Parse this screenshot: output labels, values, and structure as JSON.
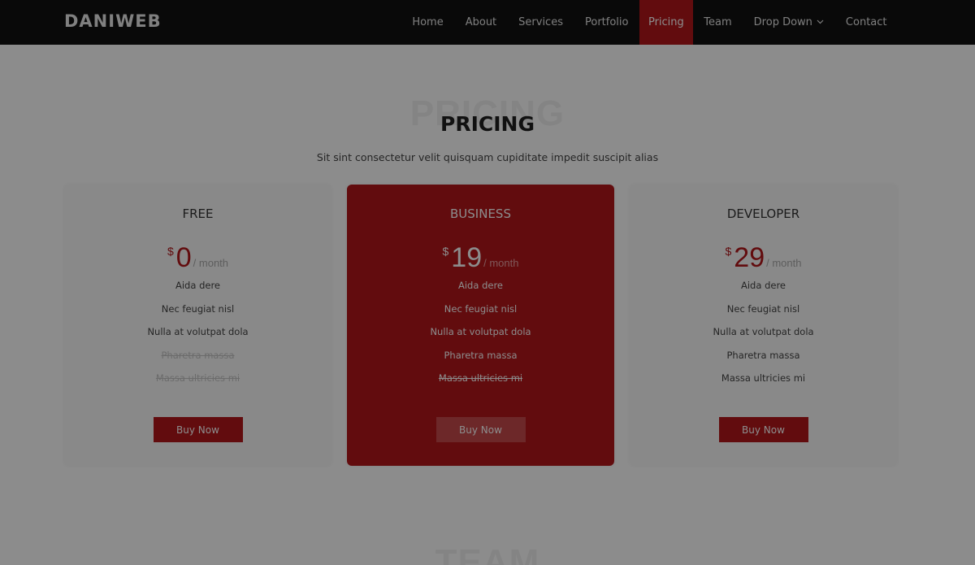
{
  "header": {
    "logo": "DANIWEB",
    "nav": [
      {
        "label": "Home"
      },
      {
        "label": "About"
      },
      {
        "label": "Services"
      },
      {
        "label": "Portfolio"
      },
      {
        "label": "Pricing",
        "active": true
      },
      {
        "label": "Team"
      },
      {
        "label": "Drop Down",
        "dropdown": true
      },
      {
        "label": "Contact"
      }
    ]
  },
  "pricing": {
    "bg_title": "PRICING",
    "title": "PRICING",
    "subtitle": "Sit sint consectetur velit quisquam cupiditate impedit suscipit alias",
    "plans": [
      {
        "name": "FREE",
        "currency": "$",
        "amount": "0",
        "period": "/ month",
        "features": [
          "Aida dere",
          "Nec feugiat nisl",
          "Nulla at volutpat dola",
          "Pharetra massa",
          "Massa ultricies mi"
        ],
        "button": "Buy Now"
      },
      {
        "name": "BUSINESS",
        "currency": "$",
        "amount": "19",
        "period": "/ month",
        "features": [
          "Aida dere",
          "Nec feugiat nisl",
          "Nulla at volutpat dola",
          "Pharetra massa",
          "Massa ultricies mi"
        ],
        "button": "Buy Now"
      },
      {
        "name": "DEVELOPER",
        "currency": "$",
        "amount": "29",
        "period": "/ month",
        "features": [
          "Aida dere",
          "Nec feugiat nisl",
          "Nulla at volutpat dola",
          "Pharetra massa",
          "Massa ultricies mi"
        ],
        "button": "Buy Now"
      }
    ]
  },
  "team": {
    "bg_title": "TEAM"
  },
  "colors": {
    "accent": "#b2161a",
    "header_bg": "#111111",
    "overlay": "rgba(0,0,0,0.45)"
  }
}
